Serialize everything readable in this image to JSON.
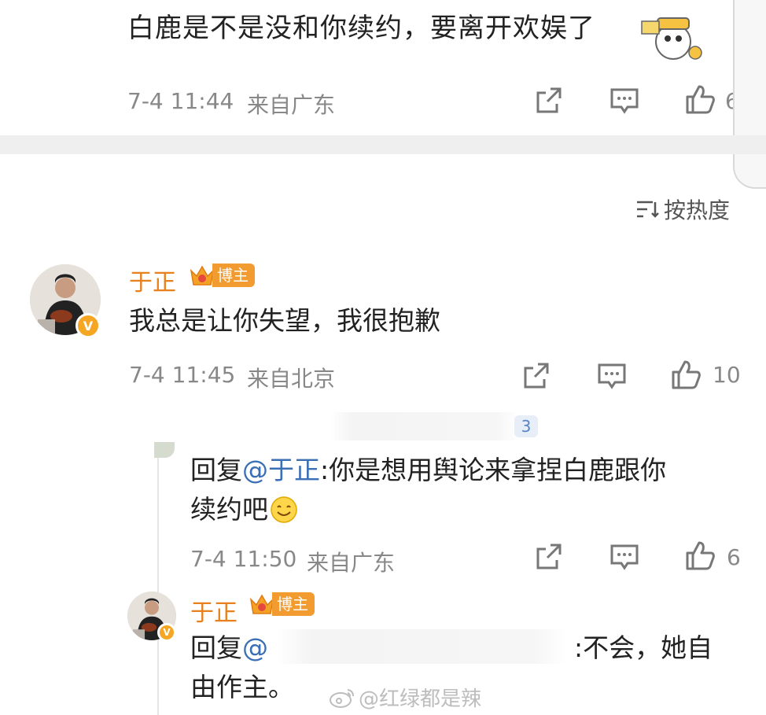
{
  "top_comment": {
    "text": "白鹿是不是没和你续约，要离开欢娱了",
    "time": "7-4 11:44",
    "source": "来自广东",
    "likes": "6"
  },
  "sort": {
    "label": "按热度"
  },
  "comment1": {
    "username": "于正",
    "badge": "博主",
    "text": "我总是让你失望，我很抱歉",
    "time": "7-4 11:45",
    "source": "来自北京",
    "likes": "10"
  },
  "reply1": {
    "badge_level": "3",
    "prefix": "回复",
    "mention": "@于正",
    "line1": ":你是想用舆论来拿捏白鹿跟你",
    "line2": "续约吧",
    "time": "7-4 11:50",
    "source": "来自广东",
    "likes": "6"
  },
  "reply2": {
    "username": "于正",
    "badge": "博主",
    "prefix": "回复",
    "mention": "@",
    "line1_suffix": ":不会，她自",
    "line2": "由作主。"
  },
  "watermark": {
    "text": "@红绿都是辣"
  },
  "colors": {
    "username": "#e8801d",
    "badge": "#f29b31",
    "mention": "#3a6fb5",
    "meta": "#888888",
    "verified": "#f5a623"
  },
  "icons": [
    "share-icon",
    "comment-icon",
    "like-icon",
    "sort-icon",
    "crown-icon",
    "weibo-logo-icon"
  ]
}
